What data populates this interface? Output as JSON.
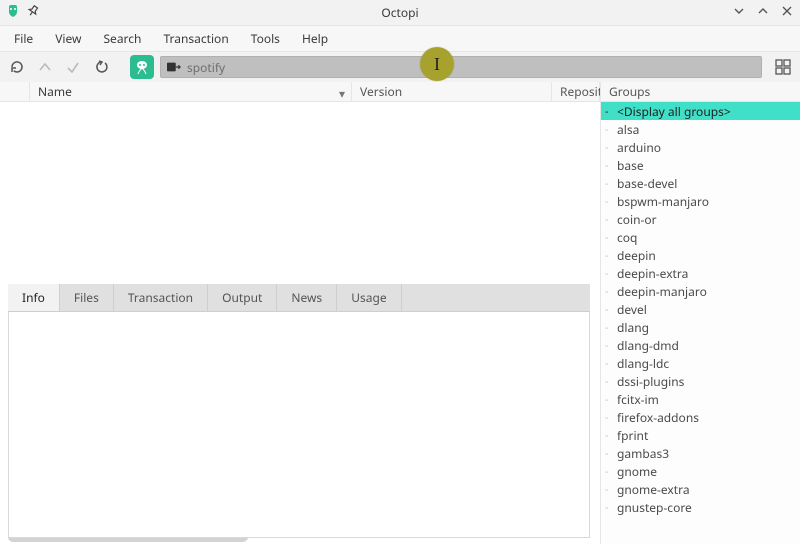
{
  "window": {
    "title": "Octopi"
  },
  "menu": {
    "items": [
      "File",
      "View",
      "Search",
      "Transaction",
      "Tools",
      "Help"
    ]
  },
  "toolbar": {
    "search_value": "spotify",
    "search_placeholder": ""
  },
  "table": {
    "columns": {
      "name": "Name",
      "version": "Version",
      "repository": "Reposito"
    }
  },
  "tabs": {
    "items": [
      "Info",
      "Files",
      "Transaction",
      "Output",
      "News",
      "Usage"
    ],
    "active": 0
  },
  "groups": {
    "header": "Groups",
    "selected": 0,
    "items": [
      "<Display all groups>",
      "alsa",
      "arduino",
      "base",
      "base-devel",
      "bspwm-manjaro",
      "coin-or",
      "coq",
      "deepin",
      "deepin-extra",
      "deepin-manjaro",
      "devel",
      "dlang",
      "dlang-dmd",
      "dlang-ldc",
      "dssi-plugins",
      "fcitx-im",
      "firefox-addons",
      "fprint",
      "gambas3",
      "gnome",
      "gnome-extra",
      "gnustep-core"
    ]
  }
}
